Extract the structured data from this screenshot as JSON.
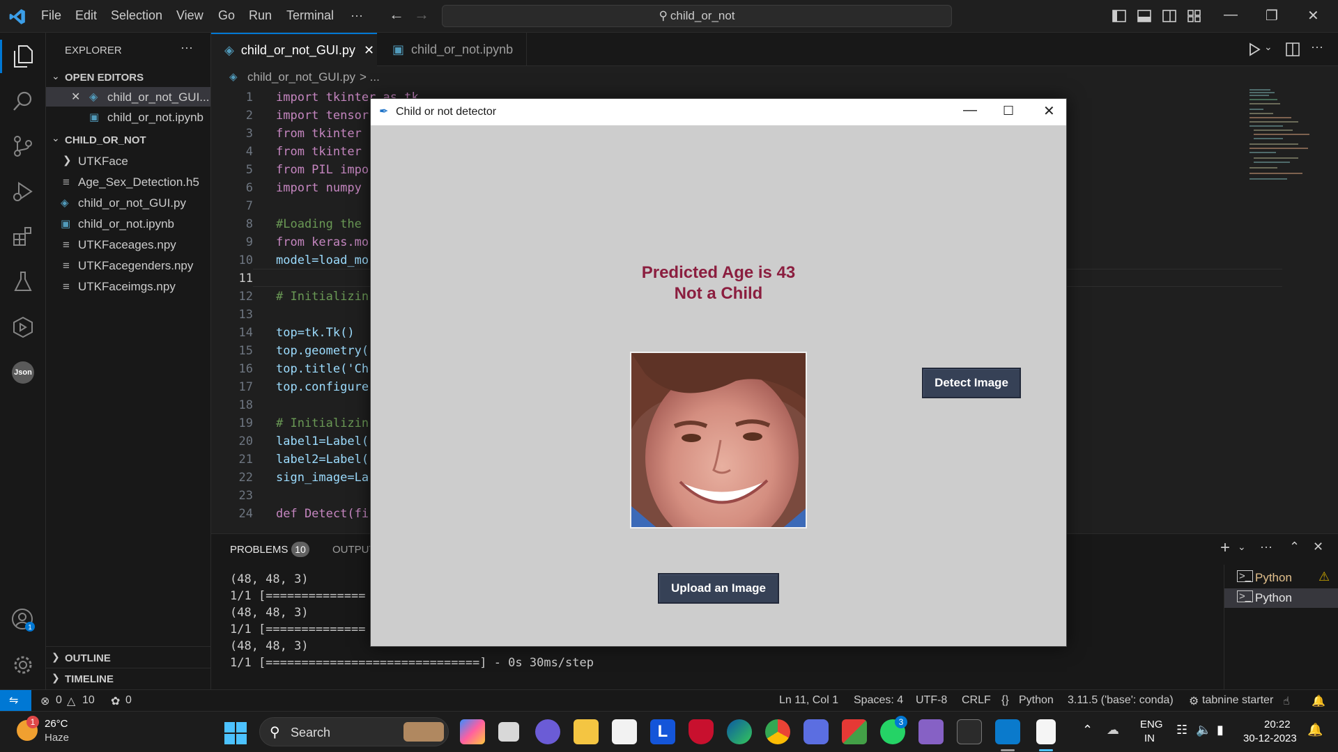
{
  "titlebar": {
    "menus": [
      "File",
      "Edit",
      "Selection",
      "View",
      "Go",
      "Run",
      "Terminal",
      "···"
    ],
    "search_text": "child_or_not"
  },
  "sidebar": {
    "title": "EXPLORER",
    "open_editors_label": "OPEN EDITORS",
    "open_editors": [
      "child_or_not_GUI...",
      "child_or_not.ipynb"
    ],
    "folder_label": "CHILD_OR_NOT",
    "files": [
      "UTKFace",
      "Age_Sex_Detection.h5",
      "child_or_not_GUI.py",
      "child_or_not.ipynb",
      "UTKFaceages.npy",
      "UTKFacegenders.npy",
      "UTKFaceimgs.npy"
    ],
    "outline_label": "OUTLINE",
    "timeline_label": "TIMELINE"
  },
  "tabs": [
    {
      "label": "child_or_not_GUI.py",
      "active": true
    },
    {
      "label": "child_or_not.ipynb",
      "active": false
    }
  ],
  "breadcrumb": {
    "file": "child_or_not_GUI.py",
    "rest": "> ..."
  },
  "code_lines": [
    {
      "n": "1",
      "text": "import tkinter as tk"
    },
    {
      "n": "2",
      "text": "import tensor"
    },
    {
      "n": "3",
      "text": "from tkinter"
    },
    {
      "n": "4",
      "text": "from tkinter"
    },
    {
      "n": "5",
      "text": "from PIL impo"
    },
    {
      "n": "6",
      "text": "import numpy"
    },
    {
      "n": "7",
      "text": ""
    },
    {
      "n": "8",
      "text": "#Loading the"
    },
    {
      "n": "9",
      "text": "from keras.mo"
    },
    {
      "n": "10",
      "text": "model=load_mo"
    },
    {
      "n": "11",
      "text": ""
    },
    {
      "n": "12",
      "text": "# Initializin"
    },
    {
      "n": "13",
      "text": ""
    },
    {
      "n": "14",
      "text": "top=tk.Tk()"
    },
    {
      "n": "15",
      "text": "top.geometry("
    },
    {
      "n": "16",
      "text": "top.title('Ch"
    },
    {
      "n": "17",
      "text": "top.configure"
    },
    {
      "n": "18",
      "text": ""
    },
    {
      "n": "19",
      "text": "# Initializin"
    },
    {
      "n": "20",
      "text": "label1=Label("
    },
    {
      "n": "21",
      "text": "label2=Label("
    },
    {
      "n": "22",
      "text": "sign_image=La"
    },
    {
      "n": "23",
      "text": ""
    },
    {
      "n": "24",
      "text": "def Detect(fi"
    }
  ],
  "panel": {
    "problems_label": "PROBLEMS",
    "problems_count": "10",
    "output_label": "OUTPUT",
    "terminal_lines": [
      "(48, 48, 3)",
      "1/1 [==============",
      "(48, 48, 3)",
      "1/1 [==============",
      "(48, 48, 3)",
      "1/1 [==============================] - 0s 30ms/step"
    ],
    "terminals": [
      "Python",
      "Python"
    ]
  },
  "statusbar": {
    "errors": "0",
    "warnings": "10",
    "ports": "0",
    "position": "Ln 11, Col 1",
    "spaces": "Spaces: 4",
    "encoding": "UTF-8",
    "eol": "CRLF",
    "language": "Python",
    "interpreter": "3.11.5 ('base': conda)",
    "tabnine": "tabnine starter"
  },
  "taskbar": {
    "weather_temp": "26°C",
    "weather_desc": "Haze",
    "weather_badge": "1",
    "search_label": "Search",
    "lang_top": "ENG",
    "lang_bottom": "IN",
    "time": "20:22",
    "date": "30-12-2023",
    "app_badge": "3"
  },
  "dialog": {
    "title": "Child or not detector",
    "prediction_line1": "Predicted Age is 43",
    "prediction_line2": "Not a Child",
    "detect_button": "Detect Image",
    "upload_button": "Upload an Image"
  },
  "colors": {
    "accent": "#0078d4",
    "prediction_text": "#8b1e3f",
    "tk_button": "#364156"
  }
}
